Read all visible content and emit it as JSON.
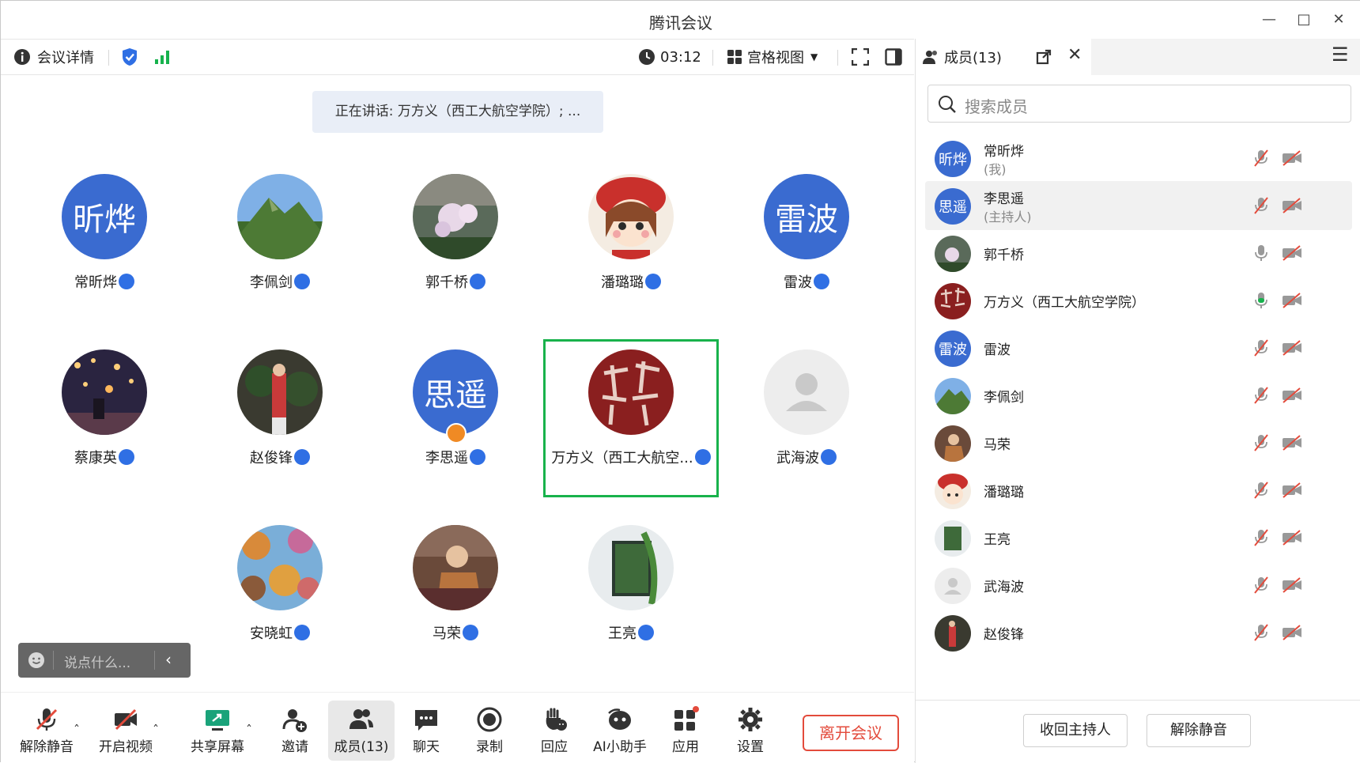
{
  "window": {
    "title": "腾讯会议"
  },
  "topbar": {
    "details_label": "会议详情",
    "timer": "03:12",
    "view_label": "宫格视图"
  },
  "stage": {
    "speaking": "正在讲话: 万方义（西工大航空学院）; ...",
    "chat_placeholder": "说点什么...",
    "tiles": [
      {
        "name": "常昕烨",
        "avatar_text": "昕烨"
      },
      {
        "name": "李佩剑"
      },
      {
        "name": "郭千桥"
      },
      {
        "name": "潘璐璐"
      },
      {
        "name": "雷波",
        "avatar_text": "雷波"
      },
      {
        "name": "蔡康英"
      },
      {
        "name": "赵俊锋"
      },
      {
        "name": "李思遥",
        "avatar_text": "思遥"
      },
      {
        "name": "万方义（西工大航空...",
        "active": true
      },
      {
        "name": "武海波"
      },
      {
        "name": "安晓虹"
      },
      {
        "name": "马荣"
      },
      {
        "name": "王亮"
      }
    ]
  },
  "bottombar": {
    "unmute": "解除静音",
    "video": "开启视频",
    "share": "共享屏幕",
    "invite": "邀请",
    "members": "成员(13)",
    "chat": "聊天",
    "record": "录制",
    "react": "回应",
    "ai": "AI小助手",
    "apps": "应用",
    "settings": "设置",
    "leave": "离开会议"
  },
  "panel": {
    "tab_label": "成员(13)",
    "search_placeholder": "搜索成员",
    "members": [
      {
        "name": "常昕烨",
        "sub": "(我)",
        "avatar_text": "昕烨"
      },
      {
        "name": "李思遥",
        "sub": "(主持人)",
        "avatar_text": "思遥"
      },
      {
        "name": "郭千桥"
      },
      {
        "name": "万方义（西工大航空学院）"
      },
      {
        "name": "雷波",
        "avatar_text": "雷波"
      },
      {
        "name": "李佩剑"
      },
      {
        "name": "马荣"
      },
      {
        "name": "潘璐璐"
      },
      {
        "name": "王亮"
      },
      {
        "name": "武海波"
      },
      {
        "name": "赵俊锋"
      }
    ],
    "reclaim_host": "收回主持人",
    "unmute_all": "解除静音"
  }
}
